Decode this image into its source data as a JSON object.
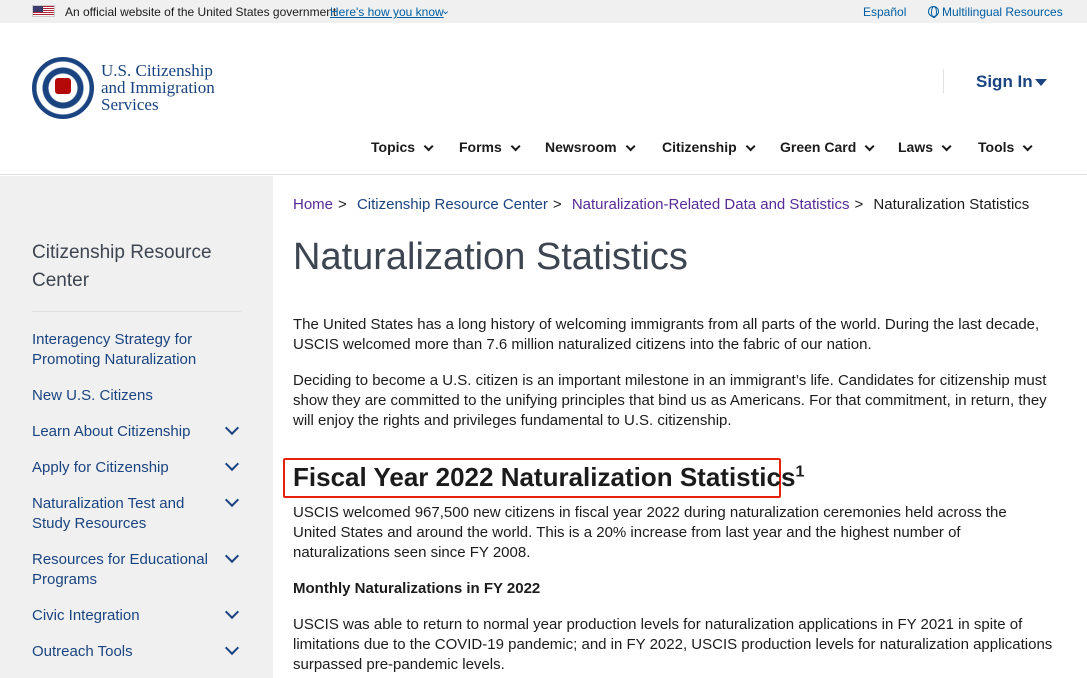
{
  "gov_banner": {
    "official_text": "An official website of the United States government",
    "how_link": "Here's how you know",
    "espanol": "Español",
    "multilingual": "Multilingual Resources"
  },
  "header": {
    "brand": "U.S. Citizenship\nand Immigration\nServices",
    "sign_in": "Sign In",
    "nav": [
      "Topics",
      "Forms",
      "Newsroom",
      "Citizenship",
      "Green Card",
      "Laws",
      "Tools"
    ]
  },
  "sidebar": {
    "title": "Citizenship Resource Center",
    "items": [
      {
        "label": "Interagency Strategy for Promoting Naturalization",
        "expandable": false
      },
      {
        "label": "New U.S. Citizens",
        "expandable": false
      },
      {
        "label": "Learn About Citizenship",
        "expandable": true
      },
      {
        "label": "Apply for Citizenship",
        "expandable": true
      },
      {
        "label": "Naturalization Test and Study Resources",
        "expandable": true
      },
      {
        "label": "Resources for Educational Programs",
        "expandable": true
      },
      {
        "label": "Civic Integration",
        "expandable": true
      },
      {
        "label": "Outreach Tools",
        "expandable": true
      }
    ]
  },
  "breadcrumb": {
    "items": [
      "Home",
      "Citizenship Resource Center",
      "Naturalization-Related Data and Statistics"
    ],
    "current": "Naturalization Statistics"
  },
  "main": {
    "title": "Naturalization Statistics",
    "intro1": "The United States has a long history of welcoming immigrants from all parts of the world. During the last decade, USCIS welcomed more than 7.6 million naturalized citizens into the fabric of our nation.",
    "intro2": "Deciding to become a U.S. citizen is an important milestone in an immigrant’s life. Candidates for citizenship must show they are committed to the unifying principles that bind us as Americans. For that commitment, in return, they will enjoy the rights and privileges fundamental to U.S. citizenship.",
    "fy_heading": "Fiscal Year 2022 Naturalization Statistics",
    "fy_footnote": "1",
    "fy_para": "USCIS welcomed 967,500 new citizens in fiscal year 2022 during naturalization ceremonies held across the United States and around the world. This is a 20% increase from last year and the highest number of naturalizations seen since FY 2008.",
    "monthly_label": "Monthly Naturalizations in FY 2022",
    "monthly_para": "USCIS was able to return to normal year production levels for naturalization applications in FY 2021 in spite of limitations due to the COVID-19 pandemic; and in FY 2022, USCIS production levels for naturalization applications surpassed pre-pandemic levels."
  }
}
